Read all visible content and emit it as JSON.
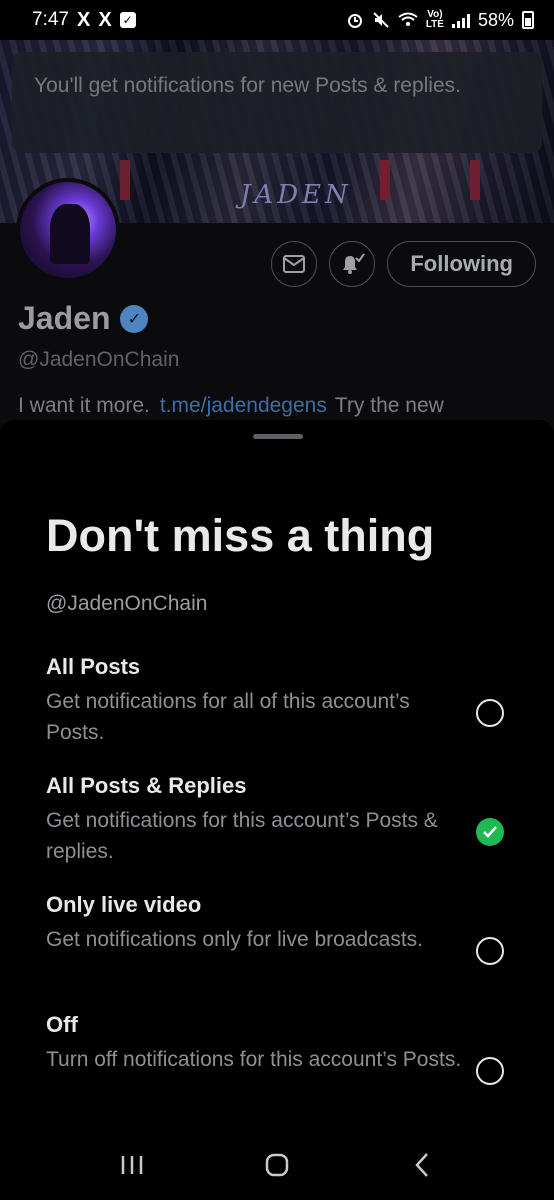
{
  "status_bar": {
    "time": "7:47",
    "x_icon_1": "X",
    "x_icon_2": "X",
    "check": "✓",
    "volte": "Vo)",
    "lte": "LTE",
    "battery": "58%"
  },
  "toast": {
    "message": "You'll get notifications for new Posts & replies."
  },
  "profile": {
    "banner_text": "JADEN",
    "name": "Jaden",
    "verified_mark": "✓",
    "handle": "@JadenOnChain",
    "bio_prefix": "I want it more.",
    "bio_link": "t.me/jadendegens",
    "bio_suffix": "Try the new",
    "following_label": "Following",
    "icons": {
      "message": "mail-icon",
      "notifications": "bell-check-icon"
    }
  },
  "sheet": {
    "title": "Don't miss a thing",
    "handle": "@JadenOnChain",
    "options": [
      {
        "title": "All Posts",
        "description": "Get notifications for all of this account’s Posts.",
        "selected": false
      },
      {
        "title": "All Posts & Replies",
        "description": "Get notifications for this account’s Posts & replies.",
        "selected": true
      },
      {
        "title": "Only live video",
        "description": "Get notifications only for live broadcasts.",
        "selected": false
      },
      {
        "title": "Off",
        "description": "Turn off notifications for this account’s Posts.",
        "selected": false
      }
    ]
  },
  "nav_bar": {
    "icons": [
      "recents-icon",
      "home-icon",
      "back-icon"
    ]
  },
  "colors": {
    "selected_radio": "#1fb954",
    "link": "#3c6ea6",
    "verified": "#4e84c4"
  }
}
